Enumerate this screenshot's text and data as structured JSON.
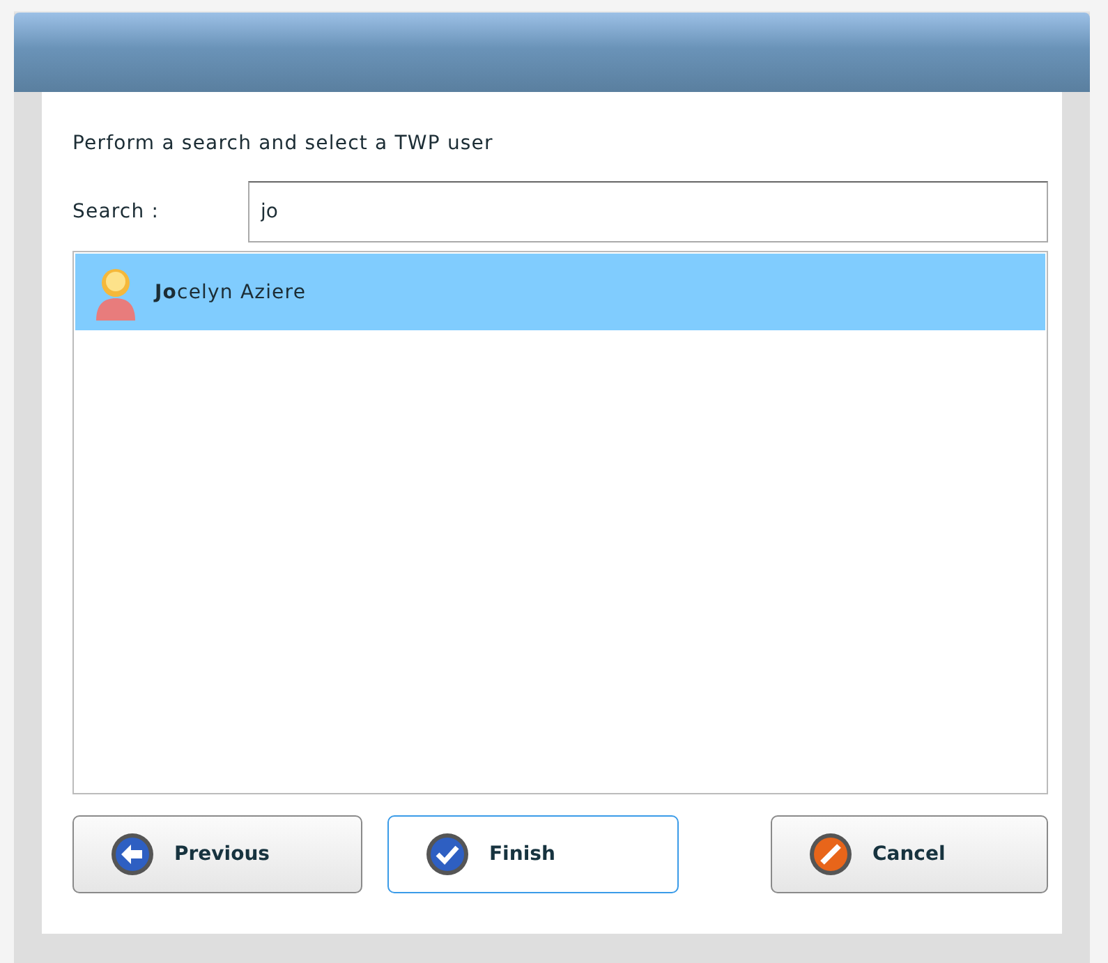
{
  "prompt": "Perform a search and select a TWP user",
  "search": {
    "label": "Search :",
    "value": "jo"
  },
  "results": [
    {
      "name": "**Jo**celyn Aziere",
      "selected": true
    }
  ],
  "buttons": [
    {
      "kind": "previous",
      "label": "Previous",
      "focused": false
    },
    {
      "kind": "finish",
      "label": "Finish",
      "focused": true
    },
    {
      "kind": "cancel",
      "label": "Cancel",
      "focused": false
    }
  ]
}
